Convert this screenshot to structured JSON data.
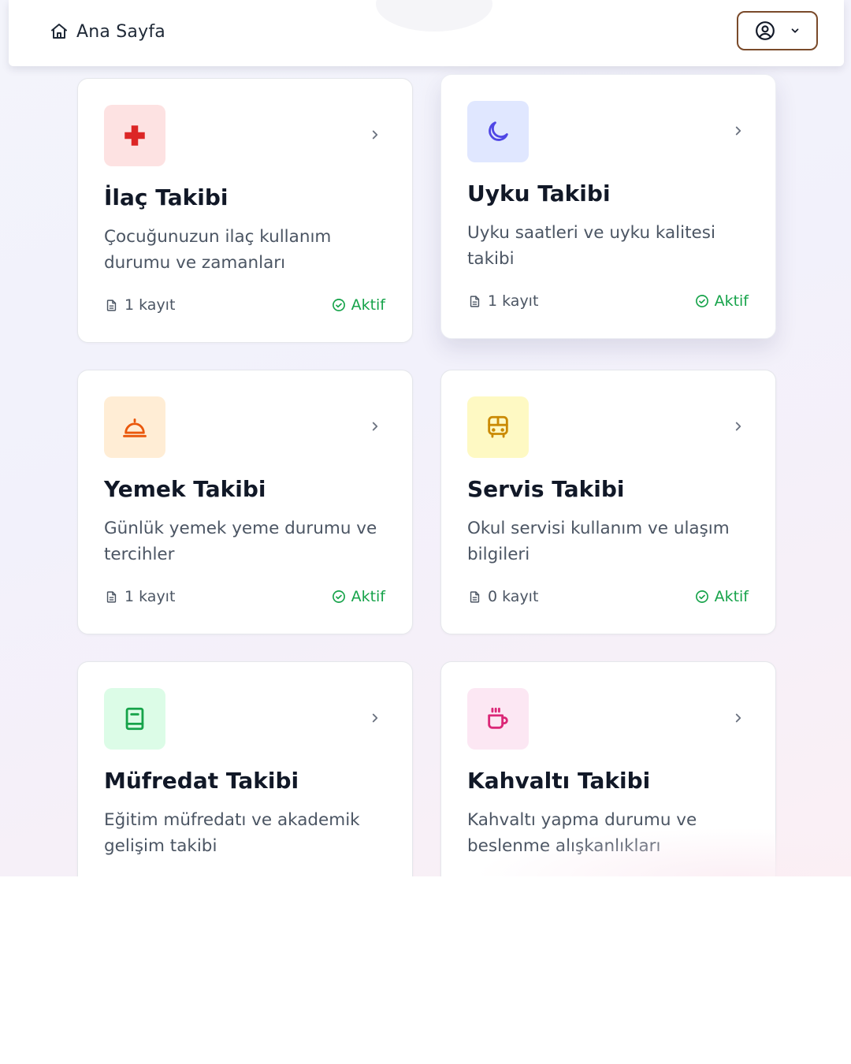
{
  "header": {
    "home_label": "Ana Sayfa"
  },
  "colors": {
    "accent_brown": "#7a4a2a",
    "status_green": "#16a34a"
  },
  "cards": [
    {
      "title": "İlaç Takibi",
      "description": "Çocuğunuzun ilaç kullanım durumu ve zamanları",
      "count": "1 kayıt",
      "status": "Aktif",
      "icon": "medical-cross-icon",
      "icon_bg": "#fde2e2",
      "icon_color": "#dc2626"
    },
    {
      "title": "Uyku Takibi",
      "description": "Uyku saatleri ve uyku kalitesi takibi",
      "count": "1 kayıt",
      "status": "Aktif",
      "icon": "moon-icon",
      "icon_bg": "#e0e7ff",
      "icon_color": "#4f46e5"
    },
    {
      "title": "Yemek Takibi",
      "description": "Günlük yemek yeme durumu ve tercihler",
      "count": "1 kayıt",
      "status": "Aktif",
      "icon": "cloche-icon",
      "icon_bg": "#ffedd5",
      "icon_color": "#ea580c"
    },
    {
      "title": "Servis Takibi",
      "description": "Okul servisi kullanım ve ulaşım bilgileri",
      "count": "0 kayıt",
      "status": "Aktif",
      "icon": "bus-icon",
      "icon_bg": "#fef9c3",
      "icon_color": "#ca8a04"
    },
    {
      "title": "Müfredat Takibi",
      "description": "Eğitim müfredatı ve akademik gelişim takibi",
      "icon": "book-icon",
      "icon_bg": "#dcfce7",
      "icon_color": "#16a34a"
    },
    {
      "title": "Kahvaltı Takibi",
      "description": "Kahvaltı yapma durumu ve beslenme alışkanlıkları",
      "icon": "coffee-cup-icon",
      "icon_bg": "#fce7f3",
      "icon_color": "#db2777"
    }
  ]
}
